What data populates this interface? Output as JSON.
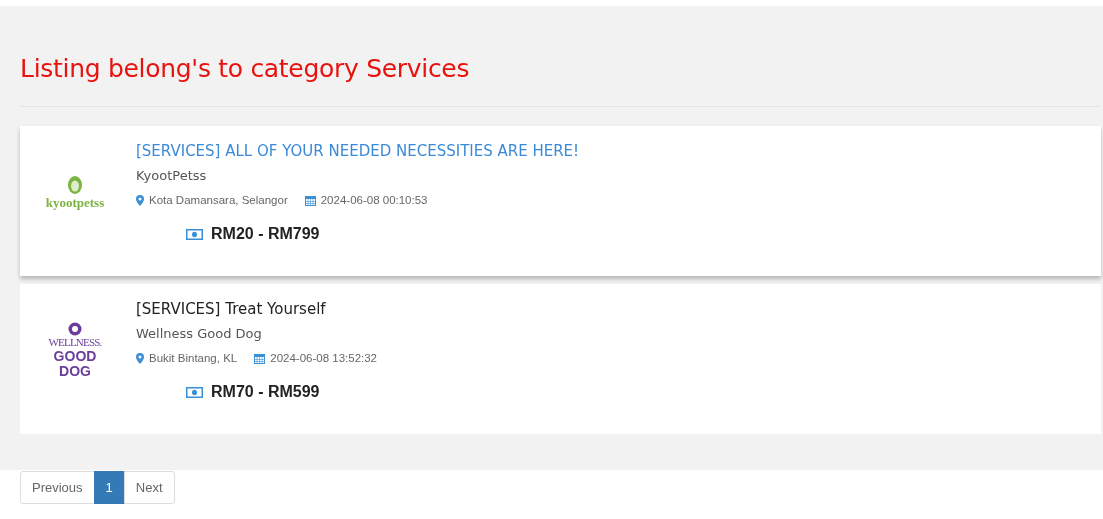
{
  "heading": "Listing belong's to category Services",
  "listings": [
    {
      "logo": {
        "kind": "lion",
        "lines": [
          "kyootpetss"
        ]
      },
      "title": "[SERVICES] ALL OF YOUR NEEDED NECESSITIES ARE HERE!",
      "seller": "KyootPetss",
      "location": "Kota Damansara, Selangor",
      "date": "2024-06-08 00:10:53",
      "price": "RM20 - RM799",
      "hovered": true
    },
    {
      "logo": {
        "kind": "dog",
        "lines": [
          "WELLNESS.",
          "GOOD",
          "DOG"
        ]
      },
      "title": "[SERVICES] Treat Yourself",
      "seller": "Wellness Good Dog",
      "location": "Bukit Bintang, KL",
      "date": "2024-06-08 13:52:32",
      "price": "RM70 - RM599",
      "hovered": false
    }
  ],
  "pagination": [
    {
      "label": "Previous",
      "selected": false
    },
    {
      "label": "1",
      "selected": true
    },
    {
      "label": "Next",
      "selected": false
    }
  ]
}
